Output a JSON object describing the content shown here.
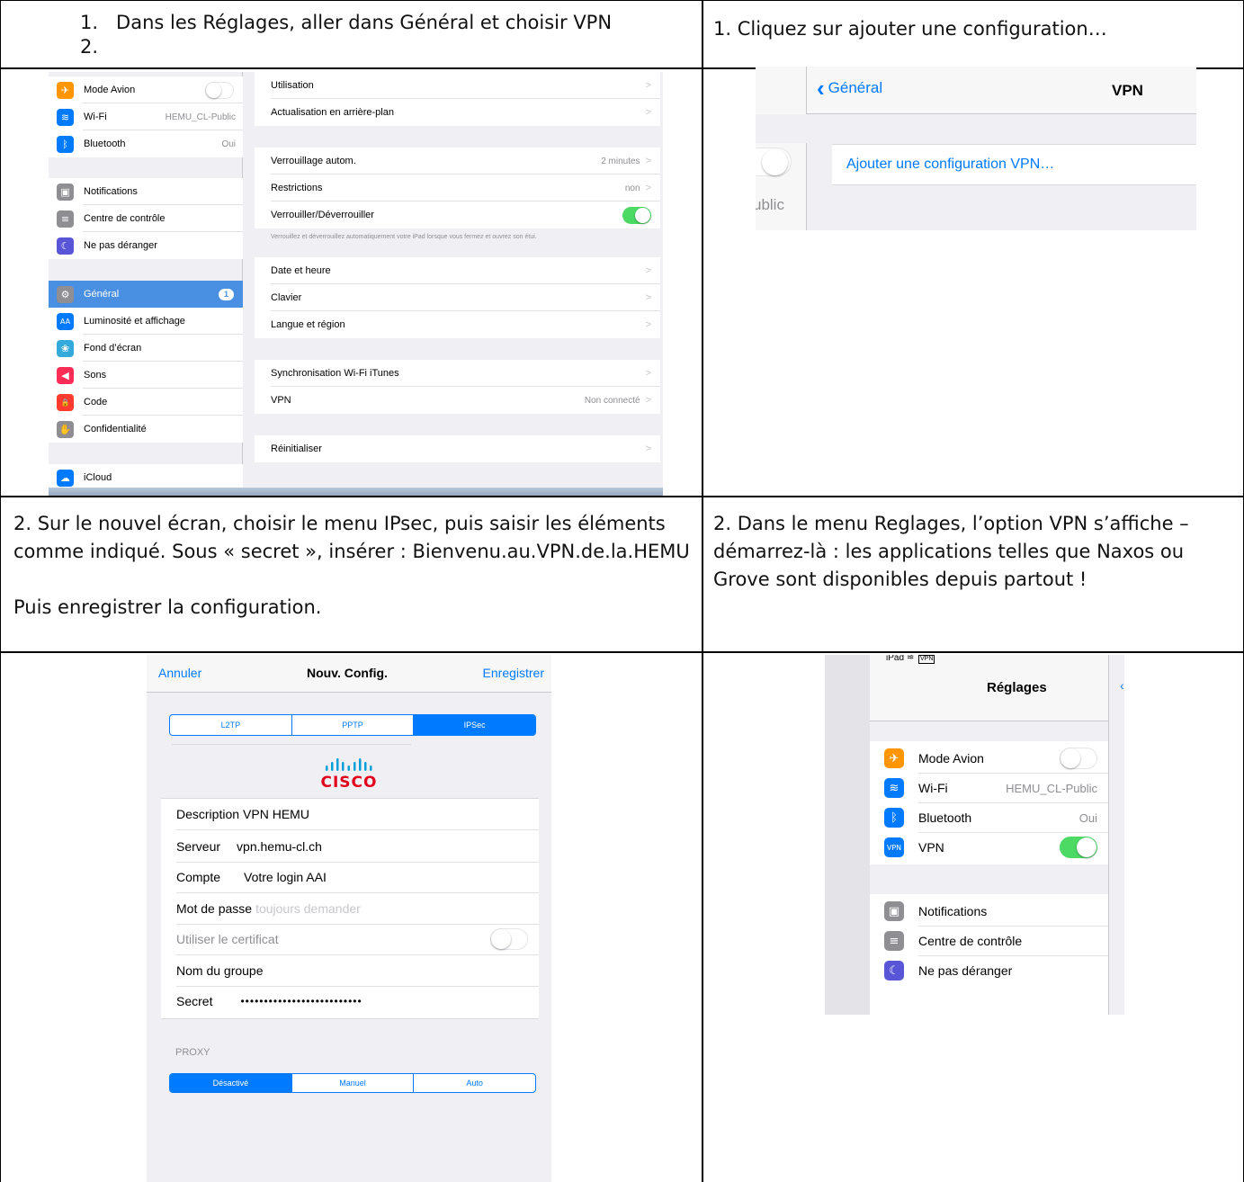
{
  "captions": {
    "top_left_line1": "1.   Dans les Réglages, aller dans Général et choisir VPN",
    "top_left_line2": "2.",
    "top_right": "1. Cliquez sur ajouter une configuration…",
    "mid_left_p1": "2. Sur le nouvel écran, choisir le menu IPsec, puis saisir les éléments comme indiqué. Sous « secret », insérer : Bienvenu.au.VPN.de.la.HEMU",
    "mid_left_p2": "Puis enregistrer la configuration.",
    "mid_right": "2. Dans le menu Reglages, l’option VPN s’affiche – démarrez-là : les applications telles que Naxos ou Grove sont disponibles depuis partout !"
  },
  "shot1": {
    "sidebar": [
      {
        "label": "Mode Avion",
        "icon": "airplane-icon",
        "color": "#ff9500",
        "glyph": "✈",
        "value": "",
        "toggle": "off"
      },
      {
        "label": "Wi-Fi",
        "icon": "wifi-icon",
        "color": "#007aff",
        "glyph": "≋",
        "value": "HEMU_CL-Public"
      },
      {
        "label": "Bluetooth",
        "icon": "bluetooth-icon",
        "color": "#007aff",
        "glyph": "ᛒ",
        "value": "Oui"
      },
      {
        "label": "Notifications",
        "icon": "notifications-icon",
        "color": "#8e8e93",
        "glyph": "▣",
        "value": ""
      },
      {
        "label": "Centre de contrôle",
        "icon": "control-center-icon",
        "color": "#8e8e93",
        "glyph": "≡",
        "value": ""
      },
      {
        "label": "Ne pas déranger",
        "icon": "moon-icon",
        "color": "#5856d6",
        "glyph": "☾",
        "value": ""
      },
      {
        "label": "Général",
        "icon": "gear-icon",
        "color": "#8e8e93",
        "glyph": "⚙",
        "badge": "1",
        "selected": true
      },
      {
        "label": "Luminosité et affichage",
        "icon": "brightness-icon",
        "color": "#007aff",
        "glyph": "AA",
        "value": ""
      },
      {
        "label": "Fond d’écran",
        "icon": "wallpaper-icon",
        "color": "#34aadc",
        "glyph": "❀",
        "value": ""
      },
      {
        "label": "Sons",
        "icon": "sound-icon",
        "color": "#ff2d55",
        "glyph": "◀",
        "value": ""
      },
      {
        "label": "Code",
        "icon": "lock-icon",
        "color": "#ff3b30",
        "glyph": "🔒",
        "value": ""
      },
      {
        "label": "Confidentialité",
        "icon": "hand-icon",
        "color": "#8e8e93",
        "glyph": "✋",
        "value": ""
      },
      {
        "label": "iCloud",
        "icon": "icloud-icon",
        "color": "#007aff",
        "glyph": "☁",
        "value": ""
      }
    ],
    "main": [
      {
        "label": "Utilisation",
        "value": ""
      },
      {
        "label": "Actualisation en arrière-plan",
        "value": ""
      },
      {
        "label": "Verrouillage autom.",
        "value": "2 minutes"
      },
      {
        "label": "Restrictions",
        "value": "non"
      },
      {
        "label": "Verrouiller/Déverrouiller",
        "value": "",
        "toggle": "on"
      },
      {
        "label": "Date et heure",
        "value": ""
      },
      {
        "label": "Clavier",
        "value": ""
      },
      {
        "label": "Langue et région",
        "value": ""
      },
      {
        "label": "Synchronisation Wi-Fi iTunes",
        "value": ""
      },
      {
        "label": "VPN",
        "value": "Non connecté"
      },
      {
        "label": "Réinitialiser",
        "value": ""
      }
    ],
    "footnote": "Verrouillez et déverrouillez automatiquement votre iPad lorsque vous fermez et ouvrez son étui."
  },
  "shot2": {
    "back_label": "Général",
    "title": "VPN",
    "add_config": "Ajouter une configuration VPN…",
    "partial_text": "ublic"
  },
  "shot3": {
    "cancel": "Annuler",
    "title": "Nouv. Config.",
    "save": "Enregistrer",
    "types": [
      "L2TP",
      "PPTP",
      "IPSec"
    ],
    "selected_type": "IPSec",
    "logo_text": "CISCO",
    "fields": [
      {
        "label": "Description",
        "value": "VPN HEMU"
      },
      {
        "label": "Serveur",
        "value": "vpn.hemu-cl.ch"
      },
      {
        "label": "Compte",
        "value": "Votre login AAI"
      },
      {
        "label": "Mot de passe",
        "value": "toujours demander",
        "placeholder": true
      },
      {
        "label": "Utiliser le certificat",
        "value": "",
        "toggle": "off",
        "dim": true
      },
      {
        "label": "Nom du groupe",
        "value": ""
      },
      {
        "label": "Secret",
        "value": "••••••••••••••••••••••••••"
      }
    ],
    "proxy_header": "PROXY",
    "proxy_options": [
      "Désactivé",
      "Manuel",
      "Auto"
    ],
    "proxy_selected": "Désactivé"
  },
  "shot4": {
    "status_left": "iPad",
    "status_vpn": "VPN",
    "title": "Réglages",
    "rows": [
      {
        "label": "Mode Avion",
        "icon": "airplane-icon",
        "color": "#ff9500",
        "glyph": "✈",
        "value": "",
        "toggle": "off"
      },
      {
        "label": "Wi-Fi",
        "icon": "wifi-icon",
        "color": "#007aff",
        "glyph": "≋",
        "value": "HEMU_CL-Public"
      },
      {
        "label": "Bluetooth",
        "icon": "bluetooth-icon",
        "color": "#007aff",
        "glyph": "ᛒ",
        "value": "Oui"
      },
      {
        "label": "VPN",
        "icon": "vpn-icon",
        "color": "#007aff",
        "glyph": "VPN",
        "value": "",
        "toggle": "on"
      },
      {
        "label": "Notifications",
        "icon": "notifications-icon",
        "color": "#8e8e93",
        "glyph": "▣",
        "value": ""
      },
      {
        "label": "Centre de contrôle",
        "icon": "control-center-icon",
        "color": "#8e8e93",
        "glyph": "≡",
        "value": ""
      },
      {
        "label": "Ne pas déranger",
        "icon": "moon-icon",
        "color": "#5856d6",
        "glyph": "☾",
        "value": ""
      }
    ]
  },
  "colors": {
    "ios_blue": "#007aff",
    "ios_green": "#4cd964",
    "ios_gray_bg": "#efeff4",
    "selected_row": "#4a90e2",
    "cisco_blue": "#049fd9"
  }
}
